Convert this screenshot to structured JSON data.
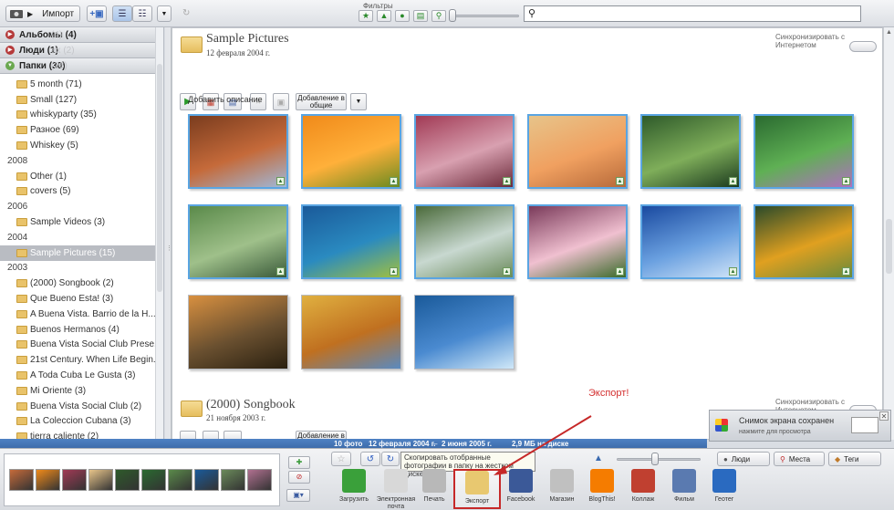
{
  "toolbar": {
    "import_label": "Импорт",
    "filters_label": "Фильтры",
    "filter_icons": [
      "star-icon",
      "upload-icon",
      "person-icon",
      "film-icon",
      "pin-icon"
    ],
    "search_placeholder": ""
  },
  "sidebar": {
    "categories": [
      {
        "label": "Альбомы (4)",
        "ghost": "(4)",
        "open": false
      },
      {
        "label": "Люди (1)",
        "ghost": "ах (2)",
        "open": false
      },
      {
        "label": "Папки (30)",
        "ghost": "(26)",
        "open": true
      }
    ],
    "top_folders": [
      "5 month (71)",
      "Small (127)",
      "whiskyparty (35)",
      "Разное (69)",
      "Whiskey (5)"
    ],
    "years": [
      {
        "year": "2008",
        "folders": [
          "Other (1)",
          "covers (5)"
        ]
      },
      {
        "year": "2006",
        "folders": [
          "Sample Videos (3)"
        ]
      },
      {
        "year": "2004",
        "folders": [
          "Sample Pictures (15)"
        ]
      },
      {
        "year": "2003",
        "folders": [
          "(2000) Songbook (2)",
          "Que Bueno Esta! (3)",
          "A Buena Vista. Barrio de la H...",
          "Buenos Hermanos (4)",
          "Buena Vista Social Club Prese...",
          "21st Century. When Life Begin...",
          "A Toda Cuba Le Gusta (3)",
          "Mi Oriente (3)",
          "Buena Vista Social Club (2)",
          "La Coleccion Cubana (3)",
          "tierra caliente (2)"
        ]
      }
    ],
    "selected": "Sample Pictures (15)"
  },
  "main": {
    "folder1": {
      "title": "Sample Pictures",
      "date": "12 февраля 2004 г.",
      "sync": "Синхронизировать с Интернетом",
      "add_shared_label": "Добавление в общие",
      "add_description": "Добавить описание"
    },
    "folder2": {
      "title": "(2000) Songbook",
      "date": "21 ноября 2003 г.",
      "sync": "Синхронизировать с Интернетом",
      "add_shared_label": "Добавление в"
    },
    "thumbs": [
      {
        "colors": [
          "#7a3c1e",
          "#c56a3a",
          "#a0b8d8"
        ]
      },
      {
        "colors": [
          "#f08a1a",
          "#ffb03a",
          "#6a8a20"
        ]
      },
      {
        "colors": [
          "#a13a55",
          "#d8a0b0",
          "#6b2a3a"
        ]
      },
      {
        "colors": [
          "#e7c48a",
          "#f0a060",
          "#b76a3a"
        ]
      },
      {
        "colors": [
          "#2e5a2a",
          "#7fae5a",
          "#1b3a1e"
        ]
      },
      {
        "colors": [
          "#2a6a30",
          "#5fb054",
          "#b070c0"
        ]
      },
      {
        "colors": [
          "#5a8a4a",
          "#9fc08a",
          "#3a5a3a"
        ]
      },
      {
        "colors": [
          "#1a5a9a",
          "#2a8ac0",
          "#a0c040"
        ]
      },
      {
        "colors": [
          "#4a6a3a",
          "#c8d8d0",
          "#6a8a5a"
        ]
      },
      {
        "colors": [
          "#7a3a5a",
          "#f0c0d0",
          "#3a6a2a"
        ]
      },
      {
        "colors": [
          "#1a4aa0",
          "#6aa0e0",
          "#d0e4f8"
        ]
      },
      {
        "colors": [
          "#2a4a2a",
          "#e0a020",
          "#6a8a3a"
        ]
      },
      {
        "colors": [
          "#d89040",
          "#6a5030",
          "#2a2010"
        ]
      },
      {
        "colors": [
          "#e0b040",
          "#c07020",
          "#5a8ac0"
        ]
      },
      {
        "colors": [
          "#1a5a9a",
          "#4a8ad0",
          "#d0e8f8"
        ]
      }
    ]
  },
  "infobar": {
    "count": "10 фото",
    "date_from": "12 февраля 2004 г.",
    "date_to": "2 июня 2005 г.",
    "size": "2,9 МБ на диске"
  },
  "notification": {
    "title": "Снимок экрана сохранен",
    "subtitle": "нажмите для просмотра"
  },
  "tray": {
    "tooltip": "Скопировать отобранные фотографии в папку на жестком диске",
    "actions": [
      {
        "label": "Загрузить",
        "icon": "upload-icon",
        "color": "#3aa03a"
      },
      {
        "label": "Электронная почта",
        "icon": "envelope-icon",
        "color": "#d8d8d8"
      },
      {
        "label": "Печать",
        "icon": "printer-icon",
        "color": "#b8b8b8"
      },
      {
        "label": "Экспорт",
        "icon": "folder-icon",
        "color": "#e8c870"
      },
      {
        "label": "Facebook",
        "icon": "facebook-icon",
        "color": "#3b5998"
      },
      {
        "label": "Магазин",
        "icon": "shop-icon",
        "color": "#c0c0c0"
      },
      {
        "label": "BlogThis!",
        "icon": "blogger-icon",
        "color": "#f57c00"
      },
      {
        "label": "Коллаж",
        "icon": "collage-icon",
        "color": "#c04030"
      },
      {
        "label": "Фильм",
        "icon": "film-icon",
        "color": "#5a7ab0"
      },
      {
        "label": "Геотег",
        "icon": "globe-icon",
        "color": "#2a6ac0"
      }
    ],
    "people_label": "Люди",
    "places_label": "Места",
    "tags_label": "Теги",
    "mini_colors": [
      "#c56a3a",
      "#f08a1a",
      "#a13a55",
      "#e7c48a",
      "#2e5a2a",
      "#2a6a30",
      "#5a8a4a",
      "#1a5a9a",
      "#6a8a5a",
      "#b07090"
    ]
  },
  "annotation": "Экспорт!"
}
